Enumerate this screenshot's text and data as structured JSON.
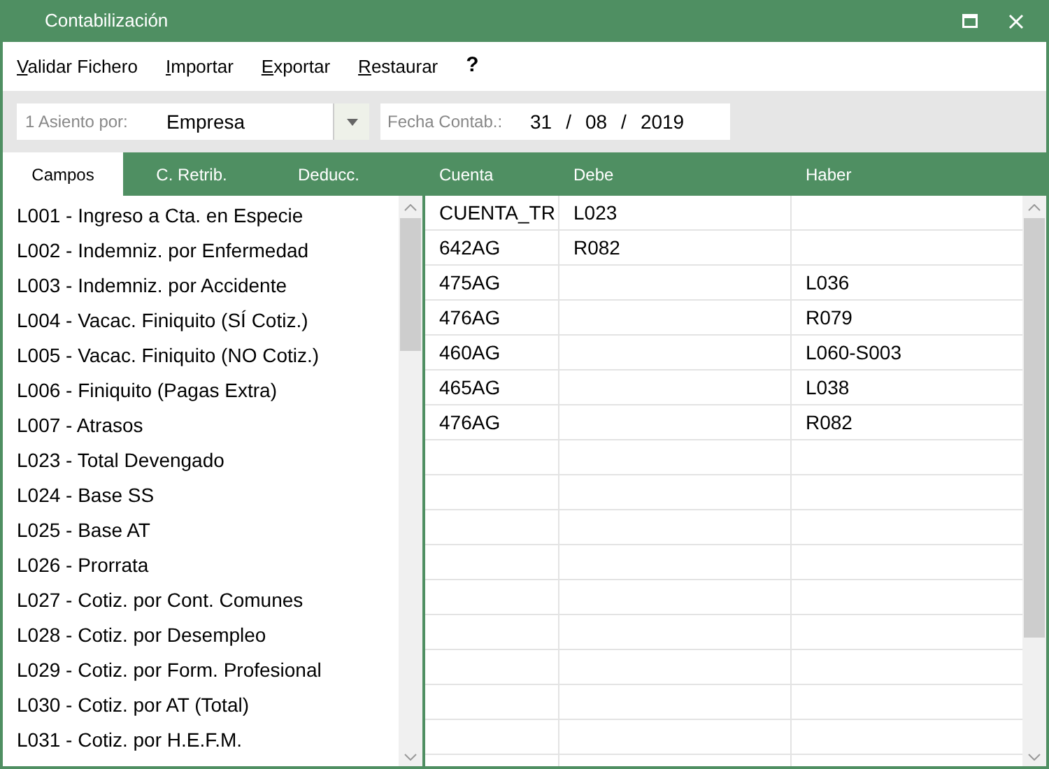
{
  "window": {
    "title": "Contabilización"
  },
  "menu": [
    "Validar Fichero",
    "Importar",
    "Exportar",
    "Restaurar",
    "?"
  ],
  "toolbar": {
    "asiento": {
      "label": "1 Asiento por:",
      "value": "Empresa"
    },
    "fecha": {
      "label": "Fecha Contab.:",
      "day": "31",
      "separator_1": "/",
      "month": "08",
      "separator_2": "/",
      "year": "2019"
    }
  },
  "tabs": [
    {
      "label": "Campos",
      "selected": true
    },
    {
      "label": "C. Retrib.",
      "selected": false
    },
    {
      "label": "Deducc.",
      "selected": false
    }
  ],
  "fields": [
    "L001 - Ingreso a Cta. en Especie",
    "L002 - Indemniz. por Enfermedad",
    "L003 - Indemniz. por Accidente",
    "L004 - Vacac. Finiquito (SÍ Cotiz.)",
    "L005 - Vacac. Finiquito (NO Cotiz.)",
    "L006 - Finiquito (Pagas Extra)",
    "L007 - Atrasos",
    "L023 - Total Devengado",
    "L024 - Base SS",
    "L025 - Base AT",
    "L026 - Prorrata",
    "L027 - Cotiz. por Cont. Comunes",
    "L028 - Cotiz. por Desempleo",
    "L029 - Cotiz. por Form. Profesional",
    "L030 - Cotiz. por AT (Total)",
    "L031 - Cotiz. por H.E.F.M."
  ],
  "table": {
    "columns": [
      "Cuenta",
      "Debe",
      "Haber"
    ],
    "rows": [
      {
        "cuenta": "CUENTA_TR",
        "debe": "L023"
      },
      {
        "cuenta": "642AG",
        "debe": "R082"
      },
      {
        "cuenta": "475AG",
        "haber": "L036"
      },
      {
        "cuenta": "476AG",
        "haber": "R079"
      },
      {
        "cuenta": "460AG",
        "haber": "L060-S003"
      },
      {
        "cuenta": "465AG",
        "haber": "L038"
      },
      {
        "cuenta": "476AG",
        "haber": "R082"
      }
    ]
  }
}
